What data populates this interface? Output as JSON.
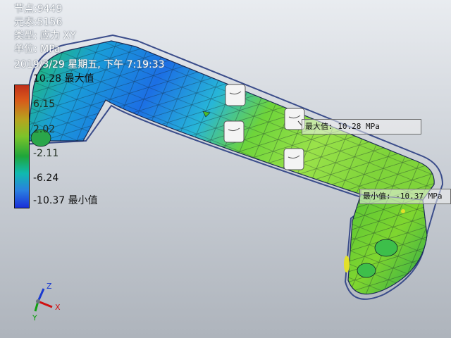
{
  "info": {
    "nodes": "节点:9449",
    "elements": "元素:5156",
    "type": "类型: 应力 XY",
    "unit": "单位: MPa",
    "timestamp": "2019/3/29 星期五, 下午 7:19:33"
  },
  "legend": {
    "max_label": "10.28 最大值",
    "tick_1": "6.15",
    "tick_2": "2.02",
    "tick_3": "-2.11",
    "tick_4": "-6.24",
    "min_label": "-10.37 最小值",
    "colors": [
      "#c0301a",
      "#b7a31e",
      "#7bc42a",
      "#1ea53a",
      "#10b9b0",
      "#2a7fe0",
      "#1a2fd8"
    ]
  },
  "callouts": {
    "max": "最大值: 10.28 MPa",
    "min": "最小值: -10.37 MPa"
  },
  "triad": {
    "x": "X",
    "y": "Y",
    "z": "Z",
    "x_color": "#d01010",
    "y_color": "#10a010",
    "z_color": "#1a3ad0"
  }
}
